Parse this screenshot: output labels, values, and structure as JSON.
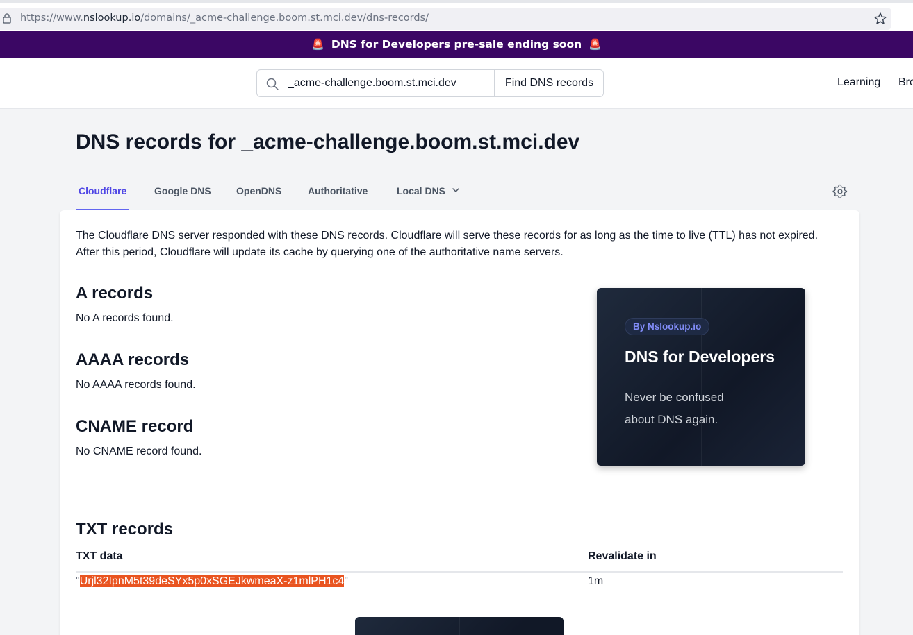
{
  "browser": {
    "url_prefix": "https://www.",
    "url_host": "nslookup.io",
    "url_path": "/domains/_acme-challenge.boom.st.mci.dev/dns-records/"
  },
  "banner": {
    "text": "DNS for Developers pre-sale ending soon",
    "siren": "🚨"
  },
  "header": {
    "search_value": "_acme-challenge.boom.st.mci.dev",
    "search_button": "Find DNS records",
    "nav": [
      "Learning",
      "Bro"
    ]
  },
  "title": {
    "prefix": "DNS records for ",
    "domain": "_acme-challenge.boom.st.mci.dev"
  },
  "tabs": {
    "items": [
      "Cloudflare",
      "Google DNS",
      "OpenDNS",
      "Authoritative",
      "Local DNS"
    ],
    "active": "Cloudflare"
  },
  "intro": "The Cloudflare DNS server responded with these DNS records. Cloudflare will serve these records for as long as the time to live (TTL) has not expired. After this period, Cloudflare will update its cache by querying one of the authoritative name servers.",
  "sections": {
    "a": {
      "heading": "A records",
      "empty": "No A records found."
    },
    "aaaa": {
      "heading": "AAAA records",
      "empty": "No AAAA records found."
    },
    "cname": {
      "heading": "CNAME record",
      "empty": "No CNAME record found."
    },
    "txt": {
      "heading": "TXT records"
    }
  },
  "ad": {
    "badge": "By Nslookup.io",
    "title": "DNS for Developers",
    "text": "Never be confused about DNS again."
  },
  "txt_table": {
    "headers": [
      "TXT data",
      "Revalidate in"
    ],
    "rows": [
      {
        "quote": "\"",
        "data": "Urjl32IpnM5t39deSYx5p0xSGEJkwmeaX-z1mlPH1c4",
        "revalidate": "1m"
      }
    ]
  },
  "colors": {
    "banner": "#3b0764",
    "accent": "#4f46e5",
    "highlight": "#e95420"
  }
}
